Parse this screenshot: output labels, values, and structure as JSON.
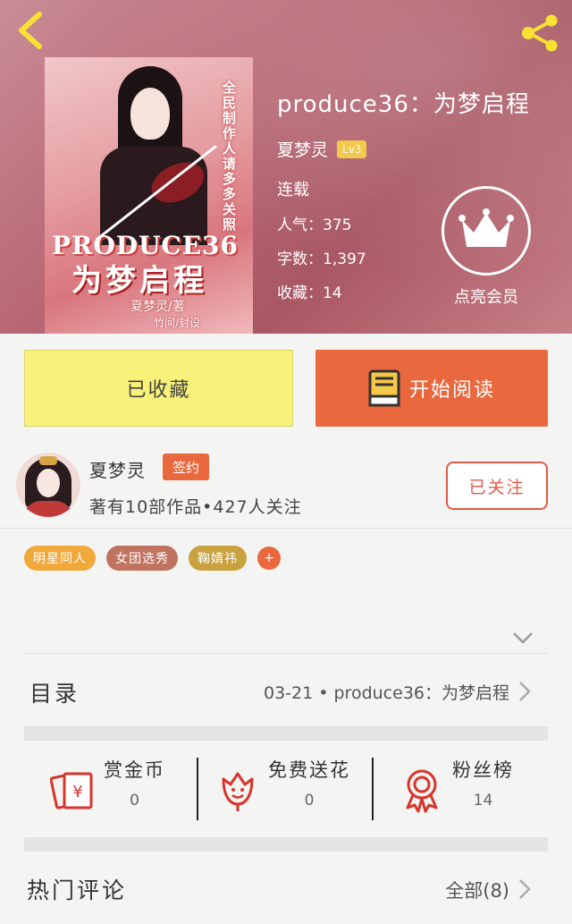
{
  "header": {
    "back_icon": "chevron-left-icon",
    "share_icon": "share-icon"
  },
  "cover": {
    "side_text": "全民制作人请多多关照",
    "title_en": "PRODUCE36",
    "title_cn": "为梦启程",
    "author": "夏梦灵/著",
    "design": "竹间/封设"
  },
  "book": {
    "title": "produce36：为梦启程",
    "author": "夏梦灵",
    "level": "Lv3",
    "status": "连载",
    "popularity": "人气：375",
    "word_count": "字数：1,397",
    "favorites": "收藏：14"
  },
  "vip": {
    "label": "点亮会员",
    "icon": "crown-icon"
  },
  "actions": {
    "collect_label": "已收藏",
    "read_label": "开始阅读",
    "read_icon": "book-icon",
    "collect_color": "#f8f27a",
    "read_color": "#e9683d"
  },
  "author": {
    "name": "夏梦灵",
    "badge": "签约",
    "meta": "著有10部作品•427人关注",
    "follow_label": "已关注"
  },
  "tags": [
    {
      "label": "明星同人",
      "color": "#f2a93b"
    },
    {
      "label": "女团选秀",
      "color": "#c0735f"
    },
    {
      "label": "鞠婧祎",
      "color": "#c9a13f"
    }
  ],
  "tag_add": "+",
  "toc": {
    "label": "目录",
    "latest": "03-21 • produce36：为梦启程"
  },
  "rewards": [
    {
      "label": "赏金币",
      "value": "0",
      "icon": "red-envelope-icon"
    },
    {
      "label": "免费送花",
      "value": "0",
      "icon": "flower-icon"
    },
    {
      "label": "粉丝榜",
      "value": "14",
      "icon": "medal-icon"
    }
  ],
  "comments": {
    "label": "热门评论",
    "all": "全部(8)"
  }
}
